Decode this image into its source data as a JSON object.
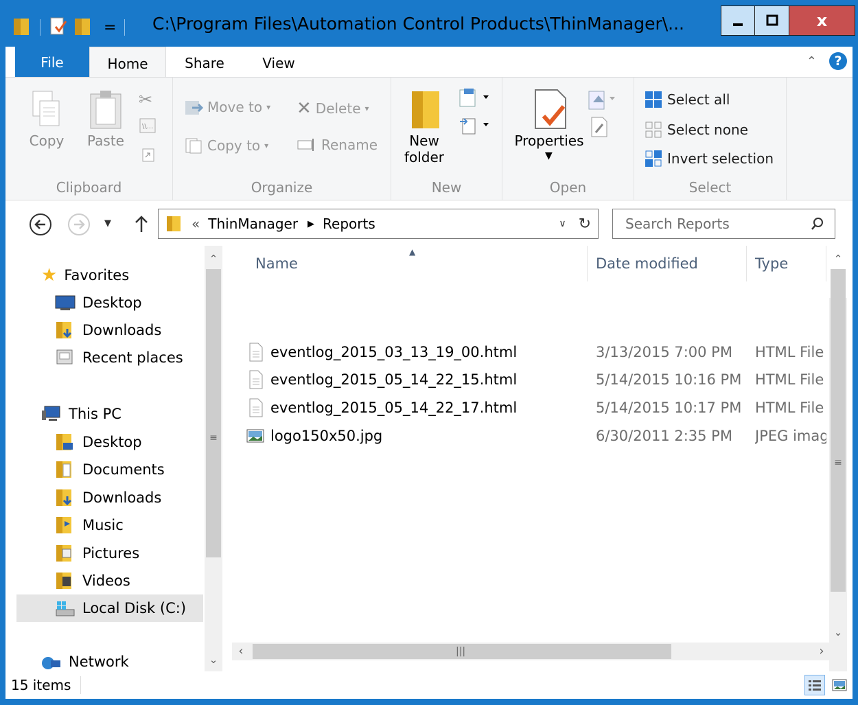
{
  "window": {
    "title": "C:\\Program Files\\Automation Control Products\\ThinManager\\...",
    "minimize_glyph": "▁",
    "maximize_glyph": "▢",
    "close_glyph": "x",
    "qat_dropdown_glyph": "="
  },
  "ribbon_tabs": {
    "file": "File",
    "home": "Home",
    "share": "Share",
    "view": "View"
  },
  "ribbon": {
    "clipboard": {
      "label": "Clipboard",
      "copy": "Copy",
      "paste": "Paste"
    },
    "organize": {
      "label": "Organize",
      "move_to": "Move to",
      "copy_to": "Copy to",
      "delete": "Delete",
      "rename": "Rename"
    },
    "new": {
      "label": "New",
      "new_folder_line1": "New",
      "new_folder_line2": "folder"
    },
    "open": {
      "label": "Open",
      "properties": "Properties"
    },
    "select": {
      "label": "Select",
      "select_all": "Select all",
      "select_none": "Select none",
      "invert_selection": "Invert selection"
    }
  },
  "address_bar": {
    "overflow": "«",
    "crumbs": [
      "ThinManager",
      "Reports"
    ],
    "search_placeholder": "Search Reports"
  },
  "nav_pane": {
    "favorites": {
      "label": "Favorites",
      "items": [
        "Desktop",
        "Downloads",
        "Recent places"
      ]
    },
    "this_pc": {
      "label": "This PC",
      "items": [
        "Desktop",
        "Documents",
        "Downloads",
        "Music",
        "Pictures",
        "Videos",
        "Local Disk (C:)"
      ]
    },
    "network": "Network"
  },
  "file_list": {
    "columns": {
      "name": "Name",
      "date": "Date modified",
      "type": "Type"
    },
    "files": [
      {
        "name": "eventlog_2015_03_13_19_00.html",
        "date": "3/13/2015 7:00 PM",
        "type": "HTML File",
        "icon": "html-file-icon"
      },
      {
        "name": "eventlog_2015_05_14_22_15.html",
        "date": "5/14/2015 10:16 PM",
        "type": "HTML File",
        "icon": "html-file-icon"
      },
      {
        "name": "eventlog_2015_05_14_22_17.html",
        "date": "5/14/2015 10:17 PM",
        "type": "HTML File",
        "icon": "html-file-icon"
      },
      {
        "name": "logo150x50.jpg",
        "date": "6/30/2011 2:35 PM",
        "type": "JPEG image",
        "icon": "jpeg-image-icon"
      }
    ]
  },
  "status": {
    "item_count": "15 items"
  },
  "colors": {
    "accent": "#1979ca",
    "close": "#c75050",
    "ribbon_bg": "#f5f6f7"
  }
}
